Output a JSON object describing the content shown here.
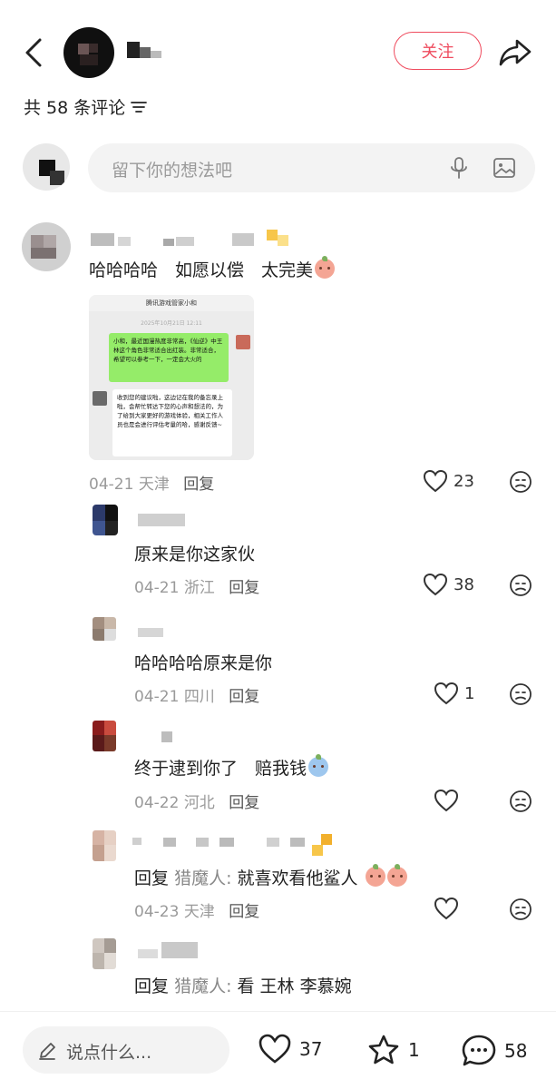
{
  "header": {
    "follow_label": "关注"
  },
  "comments_header": {
    "count_text": "共 58 条评论"
  },
  "composer": {
    "placeholder": "留下你的想法吧"
  },
  "comments": [
    {
      "text": "哈哈哈哈　如愿以偿　太完美",
      "image": {
        "title": "腾讯游戏管家小和",
        "date": "2025年10月21日 12:11",
        "sent": "小和，最近国漫热度非常高，《仙逆》中王林这个角色非常适合出红装。非常适合，希望可以参考一下，一定会大火的",
        "received": "收到您的建议啦，这边记在我的备忘录上啦，会帮忙转达下您的心声和想法的，为了给到大家更好的游戏体验，相关工作人员也是会进行评估考量的哈，感谢反馈~"
      },
      "date": "04-21",
      "location": "天津",
      "reply": "回复",
      "likes": "23"
    },
    {
      "text": "原来是你这家伙",
      "date": "04-21",
      "location": "浙江",
      "reply": "回复",
      "likes": "38"
    },
    {
      "text": "哈哈哈哈原来是你",
      "date": "04-21",
      "location": "四川",
      "reply": "回复",
      "likes": "1"
    },
    {
      "text": "终于逮到你了　赔我钱",
      "date": "04-22",
      "location": "河北",
      "reply": "回复",
      "likes": ""
    },
    {
      "prefix": "回复",
      "mention": "猎魔人:",
      "text": " 就喜欢看他鲨人",
      "date": "04-23",
      "location": "天津",
      "reply": "回复",
      "likes": ""
    },
    {
      "prefix": "回复",
      "mention": "猎魔人:",
      "text": " 看 王林 李慕婉"
    }
  ],
  "bottom_bar": {
    "say_placeholder": "说点什么...",
    "likes": "37",
    "stars": "1",
    "comments": "58"
  }
}
